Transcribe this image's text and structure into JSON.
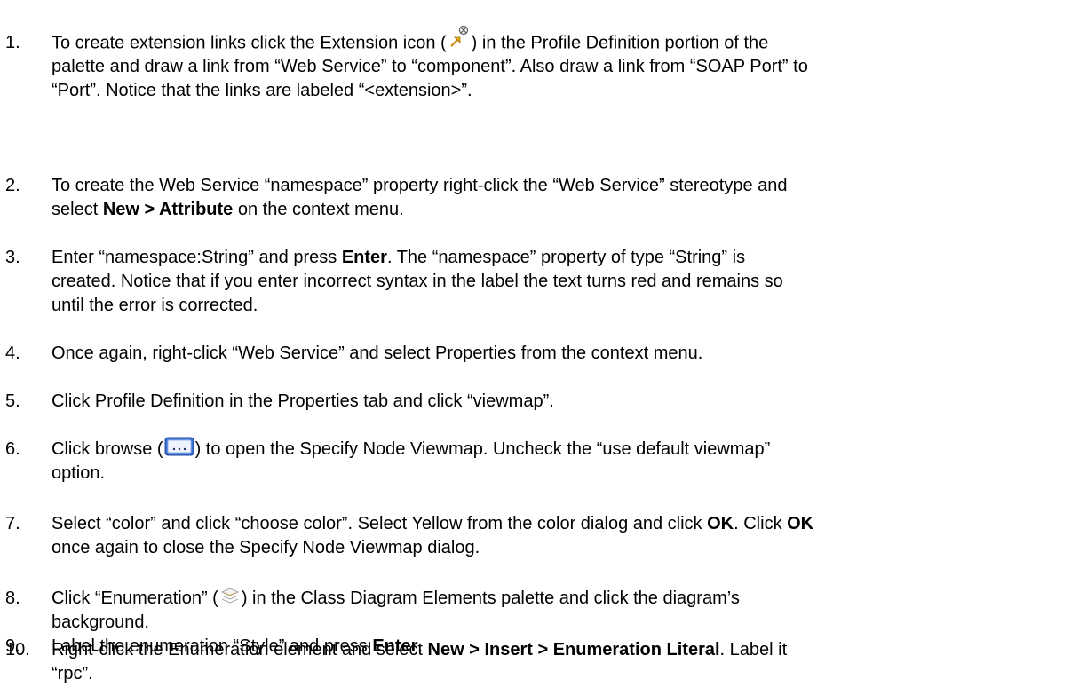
{
  "steps": [
    {
      "number": "1.",
      "lines": [
        [
          {
            "t": "To create extension links click the Extension icon ("
          },
          {
            "icon": "extension-icon"
          },
          {
            "t": ")  in the Profile Definition portion of the"
          }
        ],
        [
          {
            "t": "palette and draw a link from “Web Service” to “component”.  Also draw a link from “SOAP Port” to"
          }
        ],
        [
          {
            "t": "“Port”.  Notice that the links are labeled “<extension>”."
          }
        ]
      ]
    },
    {
      "number": "2.",
      "lines": [
        [
          {
            "t": "To create the Web Service “namespace” property right-click the “Web Service” stereotype and"
          }
        ],
        [
          {
            "t": "select "
          },
          {
            "b": "New > Attribute"
          },
          {
            "t": " on the context menu."
          }
        ]
      ]
    },
    {
      "number": "3.",
      "lines": [
        [
          {
            "t": "Enter “namespace:String” and press "
          },
          {
            "b": "Enter"
          },
          {
            "t": ".  The “namespace” property of type “String” is"
          }
        ],
        [
          {
            "t": "created. Notice that if you enter incorrect syntax in the label the text turns red and remains so"
          }
        ],
        [
          {
            "t": "until the error is corrected."
          }
        ]
      ]
    },
    {
      "number": "4.",
      "lines": [
        [
          {
            "t": "Once again, right-click “Web Service” and select Properties from the context menu."
          }
        ]
      ]
    },
    {
      "number": "5.",
      "lines": [
        [
          {
            "t": "Click Profile Definition in the Properties tab and click “viewmap”."
          }
        ]
      ]
    },
    {
      "number": "6.",
      "lines": [
        [
          {
            "t": "Click browse ("
          },
          {
            "icon": "browse-icon"
          },
          {
            "t": ") to open the Specify Node Viewmap.  Uncheck the “use default viewmap”"
          }
        ],
        [
          {
            "t": "option."
          }
        ]
      ]
    },
    {
      "number": "7.",
      "lines": [
        [
          {
            "t": "Select “color” and click “choose color”. Select Yellow from the color dialog and click "
          },
          {
            "b": "OK"
          },
          {
            "t": ". Click "
          },
          {
            "b": "OK"
          }
        ],
        [
          {
            "t": "once again to close the Specify Node Viewmap dialog."
          }
        ]
      ]
    },
    {
      "number": "8.",
      "lines": [
        [
          {
            "t": "Click “Enumeration” ("
          },
          {
            "icon": "enumeration-icon"
          },
          {
            "t": ") in the Class Diagram Elements palette and click the diagram’s"
          }
        ],
        [
          {
            "t": "background."
          }
        ]
      ]
    },
    {
      "number": "9.",
      "lines": [
        [
          {
            "t": "Label the enumeration “Style” and press "
          },
          {
            "b": "Enter"
          },
          {
            "t": "."
          }
        ]
      ]
    },
    {
      "number": "10.",
      "lines": [
        [
          {
            "t": "Right-click the Enumeration element and select "
          },
          {
            "b": "New > Insert > Enumeration Literal"
          },
          {
            "t": ". Label it"
          }
        ],
        [
          {
            "t": "“rpc”."
          }
        ]
      ]
    }
  ]
}
